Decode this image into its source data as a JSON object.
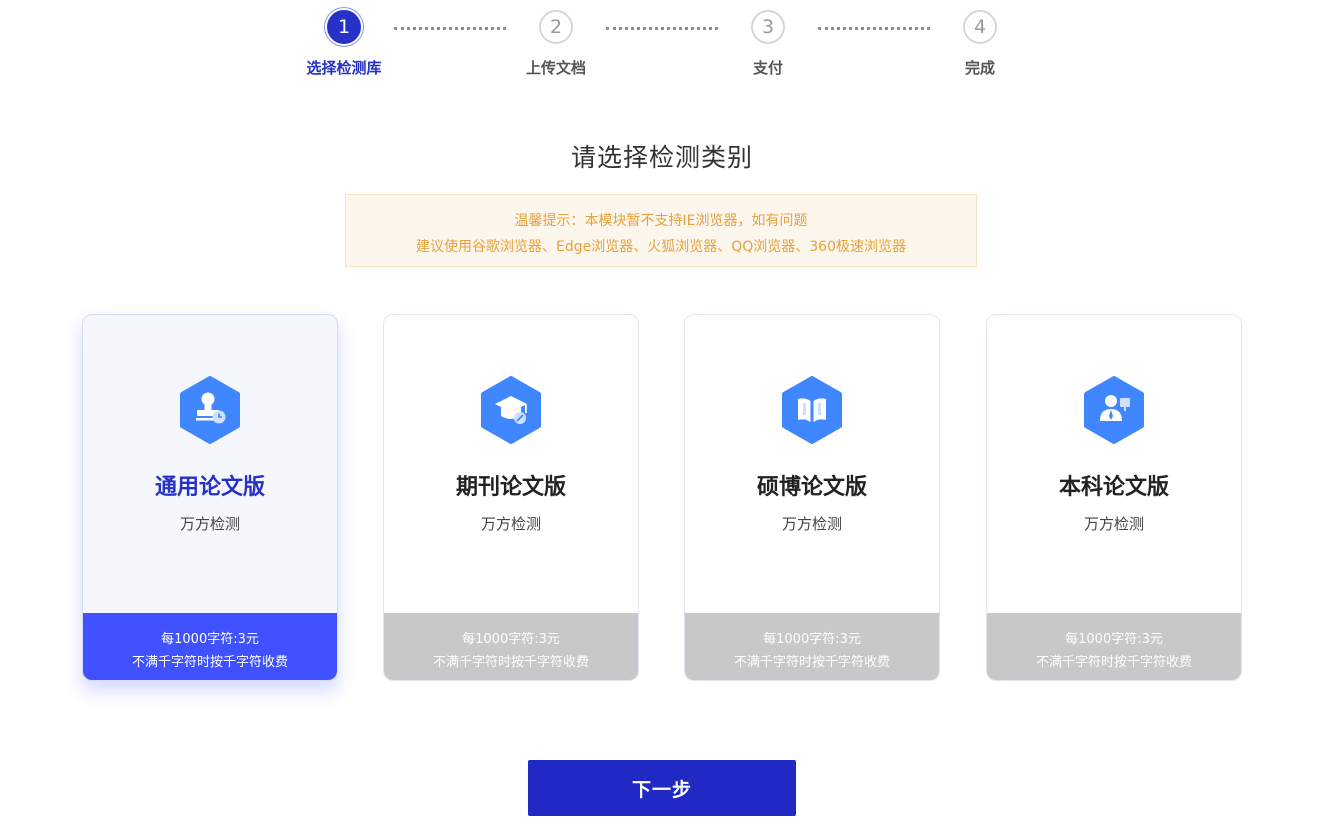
{
  "steps": [
    {
      "number": "1",
      "label": "选择检测库",
      "active": true
    },
    {
      "number": "2",
      "label": "上传文档",
      "active": false
    },
    {
      "number": "3",
      "label": "支付",
      "active": false
    },
    {
      "number": "4",
      "label": "完成",
      "active": false
    }
  ],
  "page_title": "请选择检测类别",
  "notice": {
    "line1": "温馨提示：本模块暂不支持IE浏览器，如有问题",
    "line2": "建议使用谷歌浏览器、Edge浏览器、火狐浏览器、QQ浏览器、360极速浏览器"
  },
  "cards": [
    {
      "title": "通用论文版",
      "subtitle": "万方检测",
      "price": "每1000字符:3元",
      "note": "不满千字符时按千字符收费",
      "icon": "stamp-icon",
      "selected": true
    },
    {
      "title": "期刊论文版",
      "subtitle": "万方检测",
      "price": "每1000字符:3元",
      "note": "不满千字符时按千字符收费",
      "icon": "graduation-cap-icon",
      "selected": false
    },
    {
      "title": "硕博论文版",
      "subtitle": "万方检测",
      "price": "每1000字符:3元",
      "note": "不满千字符时按千字符收费",
      "icon": "open-book-icon",
      "selected": false
    },
    {
      "title": "本科论文版",
      "subtitle": "万方检测",
      "price": "每1000字符:3元",
      "note": "不满千字符时按千字符收费",
      "icon": "teacher-icon",
      "selected": false
    }
  ],
  "next_button": "下一步",
  "colors": {
    "primary": "#2531c7",
    "selected_footer": "#4052ff",
    "icon_blue": "#4086ff",
    "disabled_footer": "#c8c8c8",
    "notice_text": "#e6a23c"
  }
}
